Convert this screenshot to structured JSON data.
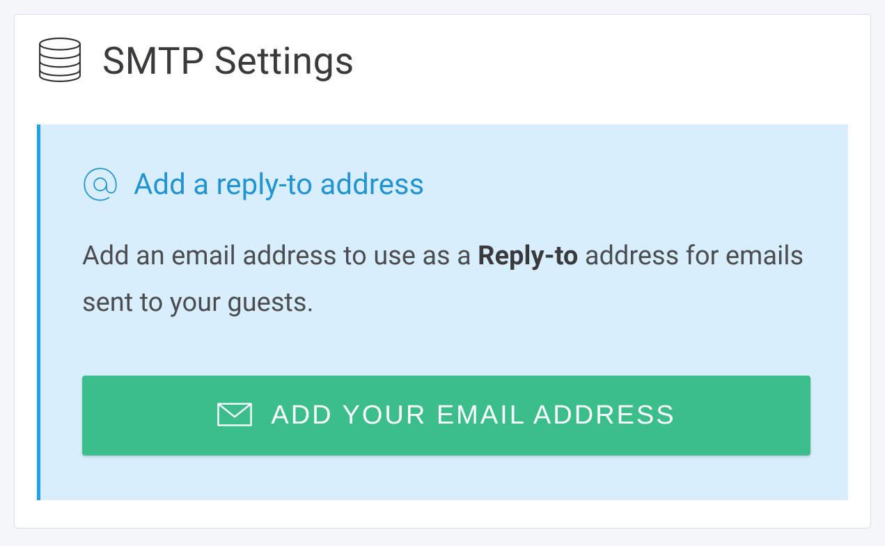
{
  "header": {
    "title": "SMTP Settings"
  },
  "callout": {
    "title": "Add a reply-to address",
    "desc_prefix": "Add an email address to use as a ",
    "desc_bold": "Reply-to",
    "desc_suffix": " address for emails sent to your guests.",
    "cta_label": "ADD YOUR EMAIL ADDRESS"
  }
}
